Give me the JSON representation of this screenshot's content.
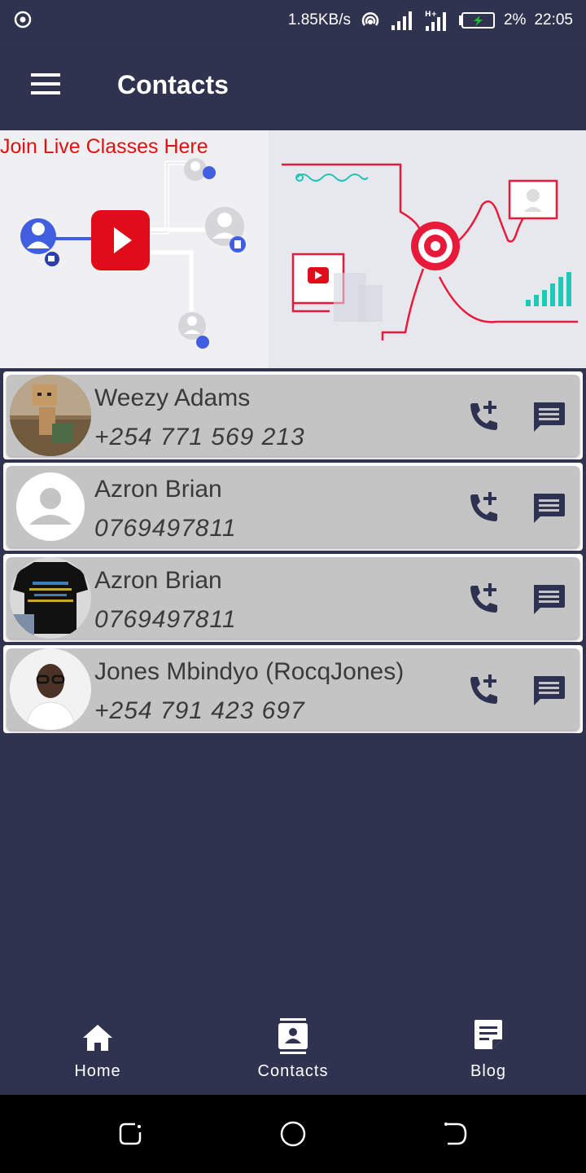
{
  "status_bar": {
    "left_icon": "target-icon",
    "speed": "1.85KB/s",
    "icons": [
      "hotspot-icon",
      "signal-icon",
      "signal-h-plus-icon",
      "battery-charging-icon"
    ],
    "battery": "2%",
    "time": "22:05",
    "battery_color": "#25c23c"
  },
  "header": {
    "menu_icon": "menu-icon",
    "title": "Contacts"
  },
  "banner": {
    "text": "Join Live Classes Here",
    "text_color": "#e01010"
  },
  "contacts": [
    {
      "name": "Weezy Adams",
      "phone": "+254 771 569 213",
      "avatar": "photo-cardboard-figure"
    },
    {
      "name": "Azron Brian",
      "phone": "0769497811",
      "avatar": "default-person-avatar"
    },
    {
      "name": "Azron Brian",
      "phone": "0769497811",
      "avatar": "photo-tshirt"
    },
    {
      "name": "Jones Mbindyo (RocqJones)",
      "phone": "+254 791 423 697",
      "avatar": "photo-man-glasses"
    }
  ],
  "contact_actions": {
    "call_icon": "add-call-icon",
    "message_icon": "message-icon"
  },
  "bottom_nav": {
    "items": [
      {
        "label": "Home",
        "icon": "home-icon"
      },
      {
        "label": "Contacts",
        "icon": "contacts-icon"
      },
      {
        "label": "Blog",
        "icon": "blog-icon"
      }
    ]
  },
  "system_nav": [
    "recents-icon",
    "home-circle-icon",
    "back-icon"
  ],
  "colors": {
    "background": "#30334f",
    "card": "#c4c4c4",
    "icon_dark": "#2e3250"
  }
}
